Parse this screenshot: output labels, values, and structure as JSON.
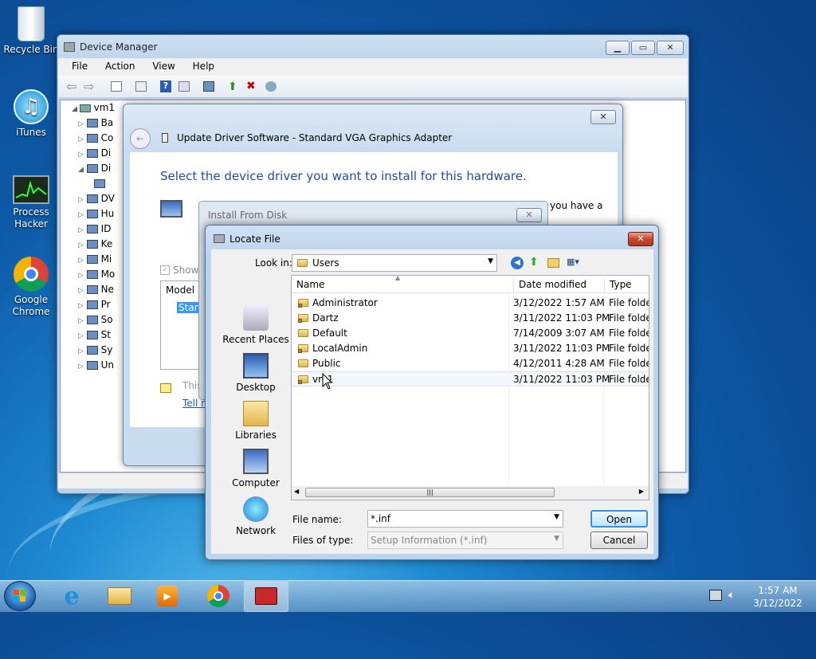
{
  "desktop": {
    "icons": [
      {
        "label": "Recycle Bin"
      },
      {
        "label": "iTunes"
      },
      {
        "label": "Process Hacker"
      },
      {
        "label": "Google Chrome"
      }
    ]
  },
  "device_manager": {
    "title": "Device Manager",
    "menu": [
      "File",
      "Action",
      "View",
      "Help"
    ],
    "root": "vm1",
    "tree_items": [
      "Ba",
      "Co",
      "Di",
      "Di",
      "",
      "DV",
      "Hu",
      "ID",
      "Ke",
      "Mi",
      "Mo",
      "Ne",
      "Pr",
      "So",
      "St",
      "Sy",
      "Un"
    ]
  },
  "update_driver": {
    "title": "Update Driver Software - Standard VGA Graphics Adapter",
    "heading": "Select the device driver you want to install for this hardware.",
    "partial_text": "you have a",
    "show_label": "Show",
    "model_header": "Model",
    "model_item": "Stand",
    "this_text": "This",
    "tell_link": "Tell n"
  },
  "install_from_disk": {
    "title": "Install From Disk"
  },
  "locate_file": {
    "title": "Locate File",
    "look_in_label": "Look in:",
    "look_in_value": "Users",
    "columns": [
      "Name",
      "Date modified",
      "Type"
    ],
    "files": [
      {
        "name": "Administrator",
        "date": "3/12/2022 1:57 AM",
        "type": "File folder",
        "locked": true
      },
      {
        "name": "Dartz",
        "date": "3/11/2022 11:03 PM",
        "type": "File folder",
        "locked": true
      },
      {
        "name": "Default",
        "date": "7/14/2009 3:07 AM",
        "type": "File folder",
        "locked": false
      },
      {
        "name": "LocalAdmin",
        "date": "3/11/2022 11:03 PM",
        "type": "File folder",
        "locked": true
      },
      {
        "name": "Public",
        "date": "4/12/2011 4:28 AM",
        "type": "File folder",
        "locked": false
      },
      {
        "name": "vm1",
        "date": "3/11/2022 11:03 PM",
        "type": "File folder",
        "locked": true
      }
    ],
    "places": [
      "Recent Places",
      "Desktop",
      "Libraries",
      "Computer",
      "Network"
    ],
    "file_name_label": "File name:",
    "file_name_value": "*.inf",
    "files_of_type_label": "Files of type:",
    "files_of_type_value": "Setup Information (*.inf)",
    "open_label": "Open",
    "cancel_label": "Cancel"
  },
  "taskbar": {
    "time": "1:57 AM",
    "date": "3/12/2022"
  }
}
